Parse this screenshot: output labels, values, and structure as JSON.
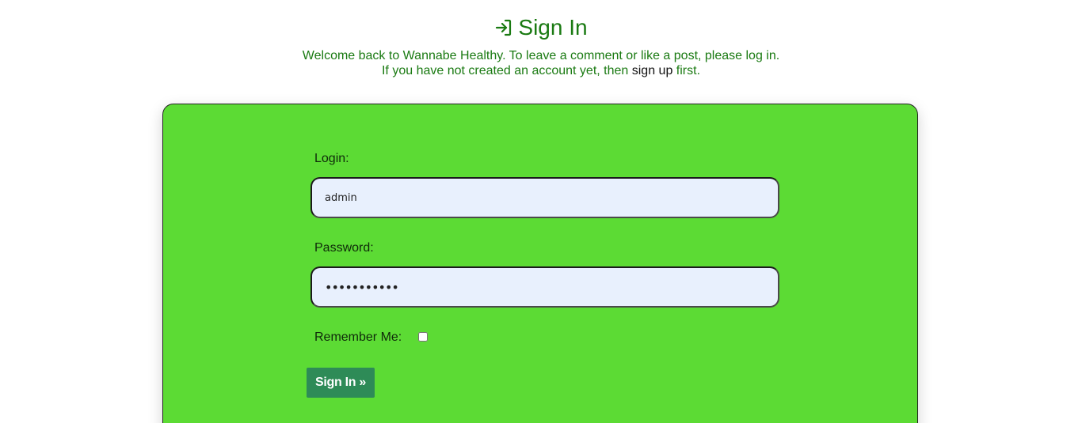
{
  "header": {
    "icon": "sign-in-icon",
    "title": "Sign In"
  },
  "intro": {
    "line1": "Welcome back to Wannabe Healthy. To leave a comment or like a post, please log in.",
    "line2_before": "If you have not created an account yet, then ",
    "signup_link": "sign up",
    "line2_after": " first."
  },
  "form": {
    "login_label": "Login:",
    "login_value": "admin",
    "password_label": "Password:",
    "password_value": "•••••••••••",
    "remember_label": "Remember Me:",
    "remember_checked": false,
    "submit_label": "Sign In »"
  },
  "colors": {
    "accent_text": "#1a7a12",
    "card_background": "#5cdb34",
    "input_background": "#e8f0fd",
    "button_background": "#2e8b57"
  }
}
